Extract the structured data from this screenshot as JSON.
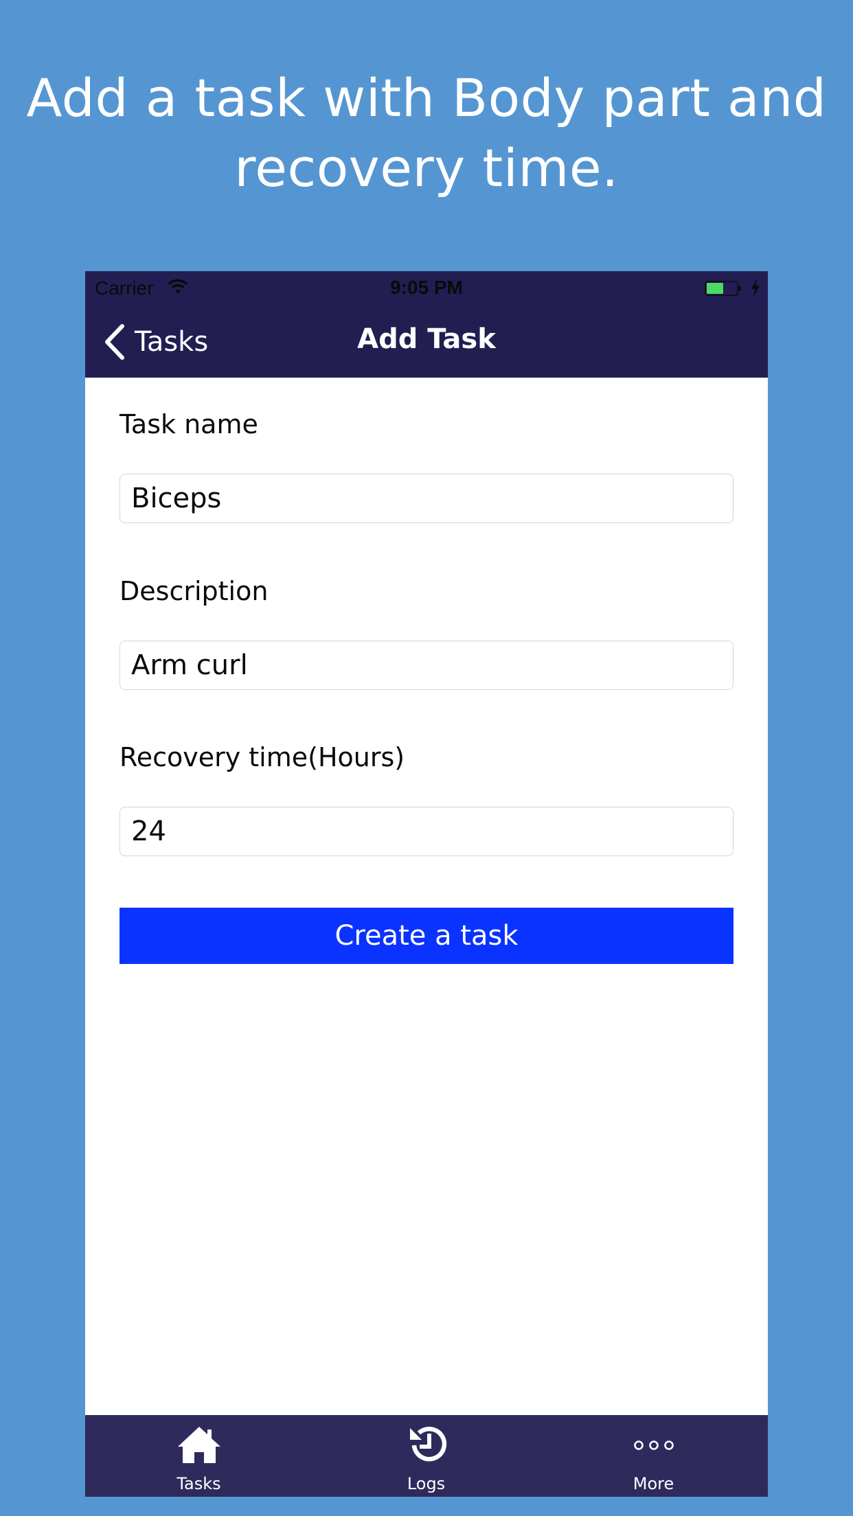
{
  "caption": {
    "line1": "Add a task with Body part and",
    "line2": "recovery time."
  },
  "status_bar": {
    "carrier": "Carrier",
    "time": "9:05 PM",
    "battery_color": "#4cd964",
    "icons": [
      "wifi-icon",
      "battery-icon",
      "charging-bolt-icon"
    ]
  },
  "nav": {
    "back_label": "Tasks",
    "title": "Add Task",
    "bar_color": "#221e52"
  },
  "form": {
    "task_name_label": "Task name",
    "task_name_value": "Biceps",
    "description_label": "Description",
    "description_value": "Arm curl",
    "recovery_label": "Recovery time(Hours)",
    "recovery_value": "24",
    "submit_label": "Create a task",
    "submit_color": "#0b33ff"
  },
  "tab_bar": {
    "color": "#2e2a5c",
    "items": [
      {
        "label": "Tasks",
        "icon": "home-icon"
      },
      {
        "label": "Logs",
        "icon": "history-icon"
      },
      {
        "label": "More",
        "icon": "more-dots-icon"
      }
    ]
  },
  "colors": {
    "background": "#5596d2",
    "caption_text": "#ffffff"
  }
}
